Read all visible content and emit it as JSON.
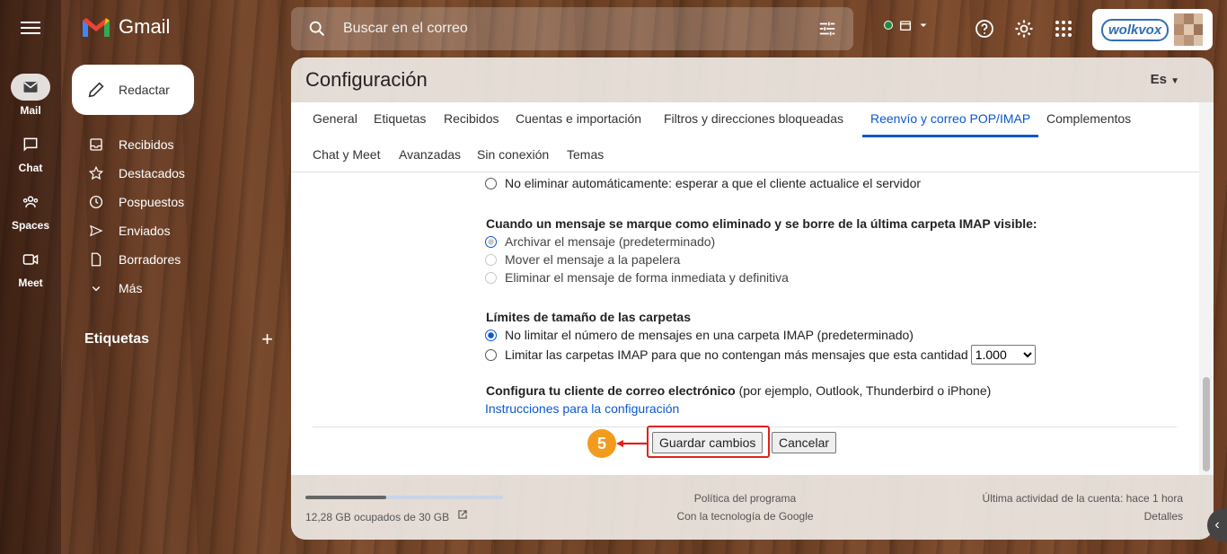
{
  "app": {
    "name": "Gmail"
  },
  "rail": [
    {
      "label": "Mail",
      "icon": "mail-icon"
    },
    {
      "label": "Chat",
      "icon": "chat-icon"
    },
    {
      "label": "Spaces",
      "icon": "spaces-icon"
    },
    {
      "label": "Meet",
      "icon": "meet-icon"
    }
  ],
  "compose": {
    "label": "Redactar"
  },
  "nav": [
    {
      "label": "Recibidos",
      "icon": "inbox-icon"
    },
    {
      "label": "Destacados",
      "icon": "star-icon"
    },
    {
      "label": "Pospuestos",
      "icon": "clock-icon"
    },
    {
      "label": "Enviados",
      "icon": "send-icon"
    },
    {
      "label": "Borradores",
      "icon": "draft-icon"
    },
    {
      "label": "Más",
      "icon": "chevron-down-icon"
    }
  ],
  "labels": {
    "title": "Etiquetas",
    "add": "+"
  },
  "search": {
    "placeholder": "Buscar en el correo"
  },
  "account": {
    "brand": "wolkvox"
  },
  "settings": {
    "title": "Configuración",
    "language": "Es",
    "tabs": [
      {
        "label": "General"
      },
      {
        "label": "Etiquetas"
      },
      {
        "label": "Recibidos"
      },
      {
        "label": "Cuentas e importación"
      },
      {
        "label": "Filtros y direcciones bloqueadas"
      },
      {
        "label": "Reenvío y correo POP/IMAP",
        "active": true
      },
      {
        "label": "Complementos"
      },
      {
        "label": "Chat y Meet"
      },
      {
        "label": "Avanzadas"
      },
      {
        "label": "Sin conexión"
      },
      {
        "label": "Temas"
      }
    ],
    "expunge_option": "No eliminar automáticamente: esperar a que el cliente actualice el servidor",
    "deleted_heading": "Cuando un mensaje se marque como eliminado y se borre de la última carpeta IMAP visible:",
    "deleted_options": [
      "Archivar el mensaje (predeterminado)",
      "Mover el mensaje a la papelera",
      "Eliminar el mensaje de forma inmediata y definitiva"
    ],
    "folder_heading": "Límites de tamaño de las carpetas",
    "folder_options": [
      "No limitar el número de mensajes en una carpeta IMAP (predeterminado)",
      "Limitar las carpetas IMAP para que no contengan más mensajes que esta cantidad"
    ],
    "folder_limit_value": "1.000",
    "client_heading": "Configura tu cliente de correo electrónico",
    "client_hint": " (por ejemplo, Outlook, Thunderbird o iPhone)",
    "client_link": "Instrucciones para la configuración",
    "save_label": "Guardar cambios",
    "cancel_label": "Cancelar",
    "step_number": "5"
  },
  "footer": {
    "storage": "12,28 GB ocupados de 30 GB",
    "storage_fraction": 0.41,
    "policy": "Política del programa",
    "powered": "Con la tecnología de Google",
    "activity": "Última actividad de la cuenta: hace 1 hora",
    "details": "Detalles"
  },
  "colors": {
    "accent": "#0b57d0",
    "highlight": "#e0211d",
    "step": "#f29b1d"
  }
}
